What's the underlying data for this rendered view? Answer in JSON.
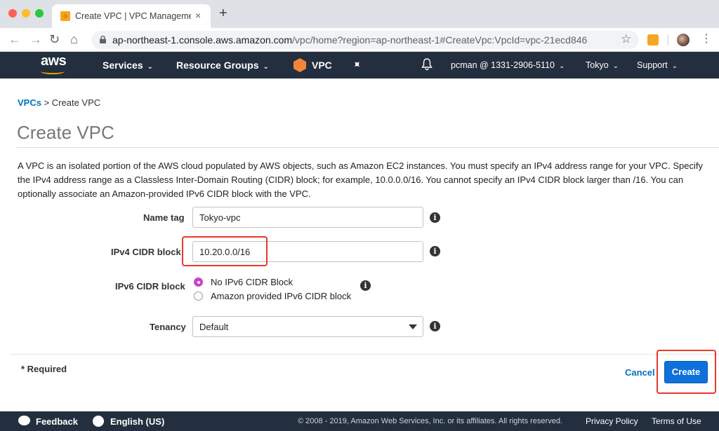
{
  "browser": {
    "tab_title": "Create VPC | VPC Management",
    "tab_close": "×",
    "new_tab": "+",
    "url_host": "ap-northeast-1.console.aws.amazon.com",
    "url_path": "/vpc/home?region=ap-northeast-1#CreateVpc:VpcId=vpc-21ecd846"
  },
  "awsnav": {
    "logo": "aws",
    "services": "Services",
    "resource_groups": "Resource Groups",
    "vpc": "VPC",
    "account": "pcman @ 1331-2906-5110",
    "region": "Tokyo",
    "support": "Support"
  },
  "breadcrumb": {
    "link": "VPCs",
    "current": "> Create VPC"
  },
  "page": {
    "title": "Create VPC",
    "description": "A VPC is an isolated portion of the AWS cloud populated by AWS objects, such as Amazon EC2 instances. You must specify an IPv4 address range for your VPC. Specify the IPv4 address range as a Classless Inter-Domain Routing (CIDR) block; for example, 10.0.0.0/16. You cannot specify an IPv4 CIDR block larger than /16. You can optionally associate an Amazon-provided IPv6 CIDR block with the VPC."
  },
  "form": {
    "name_tag": {
      "label": "Name tag",
      "value": "Tokyo-vpc"
    },
    "ipv4": {
      "label": "IPv4 CIDR block",
      "value": "10.20.0.0/16"
    },
    "ipv6": {
      "label": "IPv6 CIDR block",
      "options": [
        "No IPv6 CIDR Block",
        "Amazon provided IPv6 CIDR block"
      ],
      "selected": "No IPv6 CIDR Block"
    },
    "tenancy": {
      "label": "Tenancy",
      "value": "Default"
    },
    "info_glyph": "i",
    "required_note": "* Required",
    "cancel": "Cancel",
    "create": "Create"
  },
  "footer": {
    "feedback": "Feedback",
    "language": "English (US)",
    "copyright": "© 2008 - 2019, Amazon Web Services, Inc. or its affiliates. All rights reserved.",
    "privacy": "Privacy Policy",
    "terms": "Terms of Use"
  },
  "colors": {
    "aws_nav": "#232f3e",
    "link": "#0073bb",
    "primary_button": "#0d71d9",
    "highlight": "#e8372b",
    "radio_selected": "#c844c9"
  }
}
